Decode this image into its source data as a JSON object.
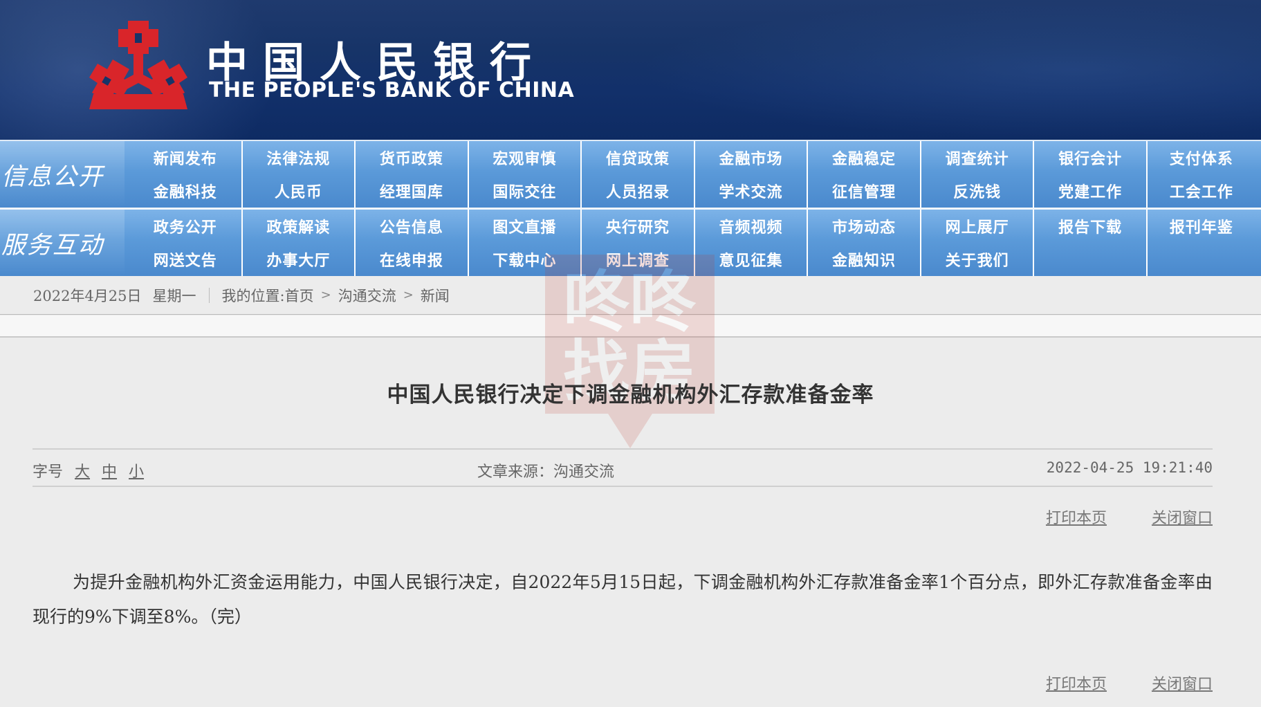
{
  "header": {
    "logo_cn": "中国人民银行",
    "logo_en": "THE PEOPLE'S BANK OF CHINA",
    "emblem_icon": "pboc-emblem-icon",
    "colors": {
      "banner": "#173468",
      "emblem": "#d9252a",
      "nav": "#5b9ad9"
    }
  },
  "nav": {
    "groups": [
      {
        "label": "信息公开",
        "rows": [
          [
            "新闻发布",
            "法律法规",
            "货币政策",
            "宏观审慎",
            "信贷政策",
            "金融市场",
            "金融稳定",
            "调查统计",
            "银行会计",
            "支付体系"
          ],
          [
            "金融科技",
            "人民币",
            "经理国库",
            "国际交往",
            "人员招录",
            "学术交流",
            "征信管理",
            "反洗钱",
            "党建工作",
            "工会工作"
          ]
        ]
      },
      {
        "label": "服务互动",
        "rows": [
          [
            "政务公开",
            "政策解读",
            "公告信息",
            "图文直播",
            "央行研究",
            "音频视频",
            "市场动态",
            "网上展厅",
            "报告下载",
            "报刊年鉴"
          ],
          [
            "网送文告",
            "办事大厅",
            "在线申报",
            "下载中心",
            "网上调查",
            "意见征集",
            "金融知识",
            "关于我们",
            "",
            ""
          ]
        ]
      }
    ]
  },
  "breadcrumb": {
    "date": "2022年4月25日",
    "weekday": "星期一",
    "prefix": "我的位置:",
    "items": [
      "首页",
      "沟通交流",
      "新闻"
    ]
  },
  "article": {
    "title": "中国人民银行决定下调金融机构外汇存款准备金率",
    "fontsize_label": "字号",
    "fontsize_options": [
      "大",
      "中",
      "小"
    ],
    "source": "文章来源：沟通交流",
    "datetime": "2022-04-25 19:21:40",
    "print_label": "打印本页",
    "close_label": "关闭窗口",
    "body": "为提升金融机构外汇资金运用能力，中国人民银行决定，自2022年5月15日起，下调金融机构外汇存款准备金率1个百分点，即外汇存款准备金率由现行的9%下调至8%。（完）"
  },
  "watermark": {
    "text_line1": "咚咚",
    "text_line2": "找房"
  }
}
